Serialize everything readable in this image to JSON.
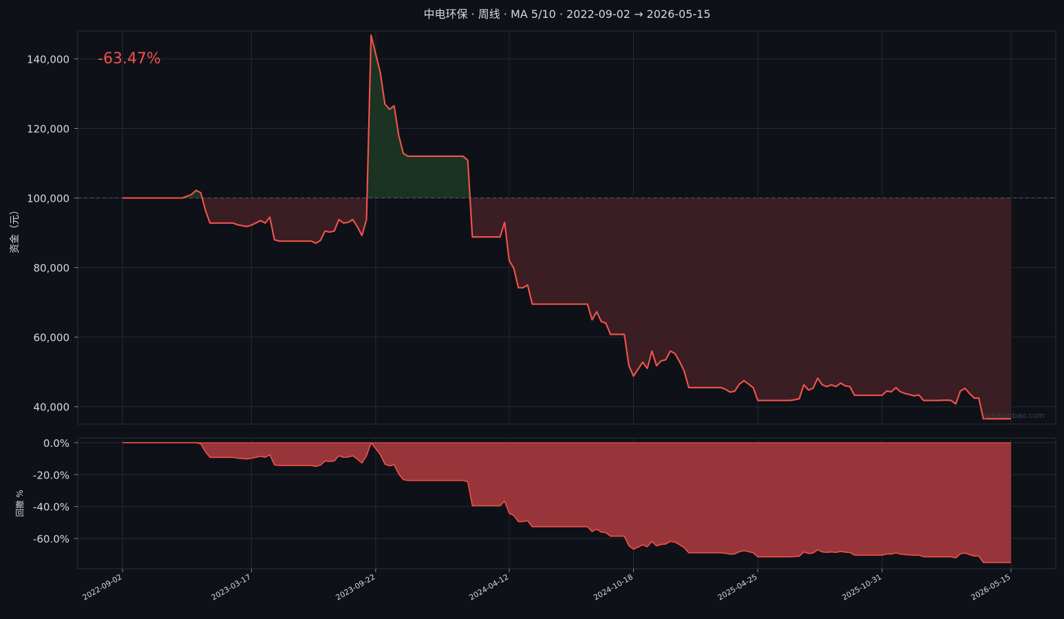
{
  "chart_data": {
    "type": "line",
    "title": "中电环保 · 周线 · MA 5/10 · 2022-09-02 → 2026-05-15",
    "return_label": "-63.47%",
    "watermark": "junxianbao.com",
    "colors": {
      "background": "#0e1117",
      "line": "#f0524b",
      "gain_fill": "#1a3323",
      "loss_fill": "#3a1e23",
      "drawdown_fill": "#98353a",
      "grid": "#262b33",
      "text": "#d9d9d9",
      "return_text": "#f0524b",
      "baseline": "#55606b"
    },
    "x_ticks": [
      "2022-09-02",
      "2023-03-17",
      "2023-09-22",
      "2024-04-12",
      "2024-10-18",
      "2025-04-25",
      "2025-10-31",
      "2026-05-15"
    ],
    "equity": {
      "ylabel": "资金（元）",
      "ylim": [
        35000,
        148000
      ],
      "yticks": [
        40000,
        60000,
        80000,
        100000,
        120000,
        140000
      ],
      "ytick_labels": [
        "40,000",
        "60,000",
        "80,000",
        "100,000",
        "120,000",
        "140,000"
      ],
      "baseline": 100000,
      "points": [
        [
          "2022-09-02",
          100000
        ],
        [
          "2022-12-02",
          100000
        ],
        [
          "2022-12-16",
          101000
        ],
        [
          "2022-12-23",
          102200
        ],
        [
          "2022-12-30",
          101500
        ],
        [
          "2023-01-06",
          96500
        ],
        [
          "2023-01-13",
          92800
        ],
        [
          "2023-02-03",
          92800
        ],
        [
          "2023-02-17",
          92800
        ],
        [
          "2023-02-24",
          92300
        ],
        [
          "2023-03-10",
          91800
        ],
        [
          "2023-03-17",
          92200
        ],
        [
          "2023-03-31",
          93500
        ],
        [
          "2023-04-07",
          92800
        ],
        [
          "2023-04-14",
          94500
        ],
        [
          "2023-04-21",
          88000
        ],
        [
          "2023-04-28",
          87600
        ],
        [
          "2023-05-26",
          87600
        ],
        [
          "2023-06-16",
          87600
        ],
        [
          "2023-06-23",
          87000
        ],
        [
          "2023-06-30",
          87800
        ],
        [
          "2023-07-07",
          90500
        ],
        [
          "2023-07-14",
          90200
        ],
        [
          "2023-07-21",
          90500
        ],
        [
          "2023-07-28",
          93800
        ],
        [
          "2023-08-04",
          92800
        ],
        [
          "2023-08-11",
          93000
        ],
        [
          "2023-08-18",
          93800
        ],
        [
          "2023-08-25",
          91800
        ],
        [
          "2023-09-01",
          89200
        ],
        [
          "2023-09-08",
          93800
        ],
        [
          "2023-09-15",
          146800
        ],
        [
          "2023-09-29",
          136000
        ],
        [
          "2023-10-06",
          127000
        ],
        [
          "2023-10-13",
          125500
        ],
        [
          "2023-10-20",
          126500
        ],
        [
          "2023-10-27",
          118000
        ],
        [
          "2023-11-03",
          112800
        ],
        [
          "2023-11-10",
          112000
        ],
        [
          "2023-12-15",
          112000
        ],
        [
          "2024-01-19",
          112000
        ],
        [
          "2024-02-02",
          112000
        ],
        [
          "2024-02-09",
          110800
        ],
        [
          "2024-02-16",
          88800
        ],
        [
          "2024-03-08",
          88800
        ],
        [
          "2024-03-29",
          88800
        ],
        [
          "2024-04-05",
          93000
        ],
        [
          "2024-04-12",
          82000
        ],
        [
          "2024-04-19",
          79800
        ],
        [
          "2024-04-26",
          74200
        ],
        [
          "2024-05-03",
          74200
        ],
        [
          "2024-05-10",
          75000
        ],
        [
          "2024-05-17",
          69500
        ],
        [
          "2024-06-21",
          69500
        ],
        [
          "2024-07-19",
          69500
        ],
        [
          "2024-08-09",
          69500
        ],
        [
          "2024-08-16",
          65000
        ],
        [
          "2024-08-23",
          67300
        ],
        [
          "2024-08-30",
          64500
        ],
        [
          "2024-09-06",
          64000
        ],
        [
          "2024-09-13",
          60800
        ],
        [
          "2024-10-04",
          60800
        ],
        [
          "2024-10-11",
          51800
        ],
        [
          "2024-10-18",
          48800
        ],
        [
          "2024-10-25",
          50800
        ],
        [
          "2024-11-01",
          52800
        ],
        [
          "2024-11-08",
          51000
        ],
        [
          "2024-11-15",
          56000
        ],
        [
          "2024-11-22",
          51800
        ],
        [
          "2024-11-29",
          53200
        ],
        [
          "2024-12-06",
          53500
        ],
        [
          "2024-12-13",
          56000
        ],
        [
          "2024-12-20",
          55300
        ],
        [
          "2024-12-27",
          53000
        ],
        [
          "2025-01-03",
          50300
        ],
        [
          "2025-01-10",
          45500
        ],
        [
          "2025-02-28",
          45500
        ],
        [
          "2025-03-07",
          45000
        ],
        [
          "2025-03-14",
          44200
        ],
        [
          "2025-03-21",
          44500
        ],
        [
          "2025-03-28",
          46500
        ],
        [
          "2025-04-04",
          47500
        ],
        [
          "2025-04-11",
          46500
        ],
        [
          "2025-04-18",
          45500
        ],
        [
          "2025-04-25",
          41800
        ],
        [
          "2025-05-16",
          41800
        ],
        [
          "2025-06-13",
          41800
        ],
        [
          "2025-06-20",
          42000
        ],
        [
          "2025-06-27",
          42300
        ],
        [
          "2025-07-04",
          46300
        ],
        [
          "2025-07-11",
          44800
        ],
        [
          "2025-07-18",
          45300
        ],
        [
          "2025-07-25",
          48200
        ],
        [
          "2025-08-01",
          46300
        ],
        [
          "2025-08-08",
          45800
        ],
        [
          "2025-08-15",
          46300
        ],
        [
          "2025-08-22",
          45800
        ],
        [
          "2025-08-29",
          46800
        ],
        [
          "2025-09-05",
          46000
        ],
        [
          "2025-09-12",
          45800
        ],
        [
          "2025-09-19",
          43300
        ],
        [
          "2025-10-31",
          43300
        ],
        [
          "2025-11-07",
          44500
        ],
        [
          "2025-11-14",
          44300
        ],
        [
          "2025-11-21",
          45500
        ],
        [
          "2025-11-28",
          44300
        ],
        [
          "2025-12-05",
          43800
        ],
        [
          "2025-12-12",
          43500
        ],
        [
          "2025-12-19",
          43100
        ],
        [
          "2025-12-26",
          43400
        ],
        [
          "2026-01-02",
          41800
        ],
        [
          "2026-01-23",
          41800
        ],
        [
          "2026-02-06",
          41900
        ],
        [
          "2026-02-13",
          41800
        ],
        [
          "2026-02-20",
          40800
        ],
        [
          "2026-02-27",
          44500
        ],
        [
          "2026-03-06",
          45300
        ],
        [
          "2026-03-13",
          43800
        ],
        [
          "2026-03-20",
          42500
        ],
        [
          "2026-03-27",
          42500
        ],
        [
          "2026-04-03",
          36530
        ],
        [
          "2026-05-15",
          36530
        ]
      ]
    },
    "drawdown": {
      "ylabel": "回撤 %",
      "ylim": [
        -79,
        3
      ],
      "yticks": [
        0,
        -20,
        -40,
        -60
      ],
      "ytick_labels": [
        "0.0%",
        "-20.0%",
        "-40.0%",
        "-60.0%"
      ]
    }
  }
}
